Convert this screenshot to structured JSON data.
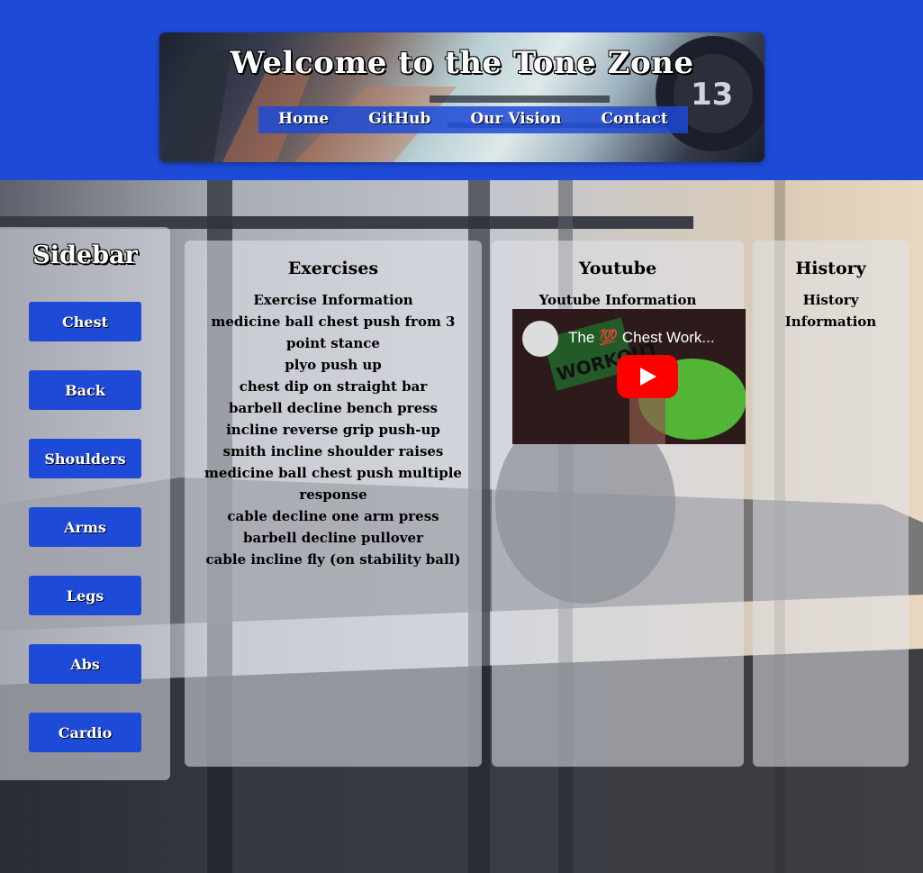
{
  "header": {
    "title": "Welcome to the Tone Zone",
    "nav": [
      "Home",
      "GitHub",
      "Our Vision",
      "Contact"
    ],
    "hero_plate_number": "13"
  },
  "sidebar": {
    "title": "Sidebar",
    "buttons": [
      "Chest",
      "Back",
      "Shoulders",
      "Arms",
      "Legs",
      "Abs",
      "Cardio"
    ]
  },
  "exercises": {
    "title": "Exercises",
    "subtitle": "Exercise Information",
    "items": [
      "medicine ball chest push from 3 point stance",
      "plyo push up",
      "chest dip on straight bar",
      "barbell decline bench press",
      "incline reverse grip push-up",
      "smith incline shoulder raises",
      "medicine ball chest push multiple response",
      "cable decline one arm press",
      "barbell decline pullover",
      "cable incline fly (on stability ball)"
    ]
  },
  "youtube": {
    "title": "Youtube",
    "subtitle": "Youtube Information",
    "video_title": "The 💯 Chest Work...",
    "thumbnail_text": "WORKOUT"
  },
  "history": {
    "title": "History",
    "subtitle": "History Information"
  },
  "colors": {
    "brand_blue": "#1d4ad6",
    "youtube_red": "#ff0000"
  }
}
